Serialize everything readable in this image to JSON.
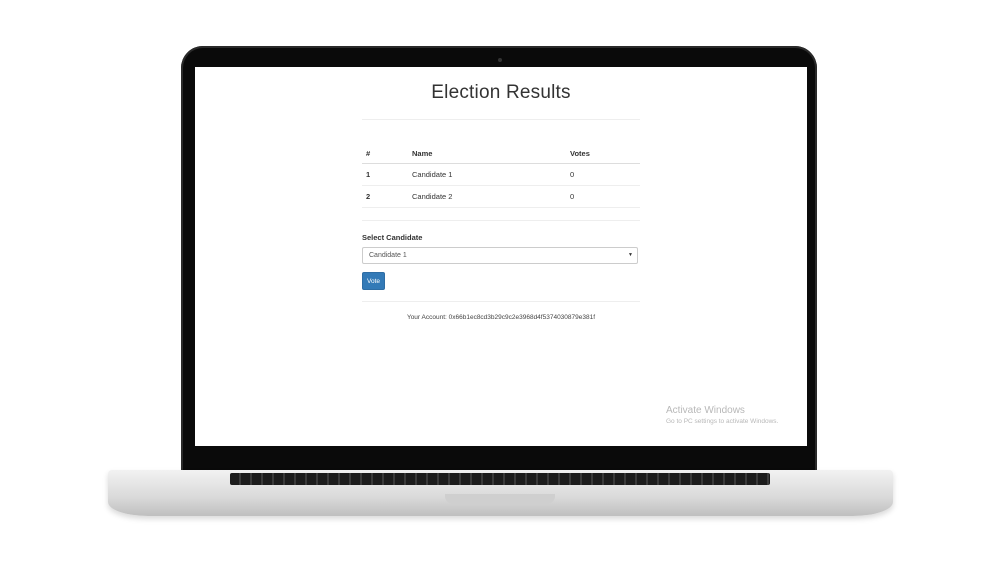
{
  "page": {
    "title": "Election Results"
  },
  "table": {
    "headers": [
      "#",
      "Name",
      "Votes"
    ],
    "rows": [
      {
        "id": "1",
        "name": "Candidate 1",
        "votes": "0"
      },
      {
        "id": "2",
        "name": "Candidate 2",
        "votes": "0"
      }
    ]
  },
  "form": {
    "select_label": "Select Candidate",
    "selected_option": "Candidate 1",
    "vote_label": "Vote"
  },
  "account": {
    "text": "Your Account: 0x66b1ec8cd3b29c9c2e3968d4f5374030879e381f"
  },
  "watermark": {
    "title": "Activate Windows",
    "subtitle": "Go to PC settings to activate Windows."
  },
  "colors": {
    "primary_button": "#337ab7"
  }
}
